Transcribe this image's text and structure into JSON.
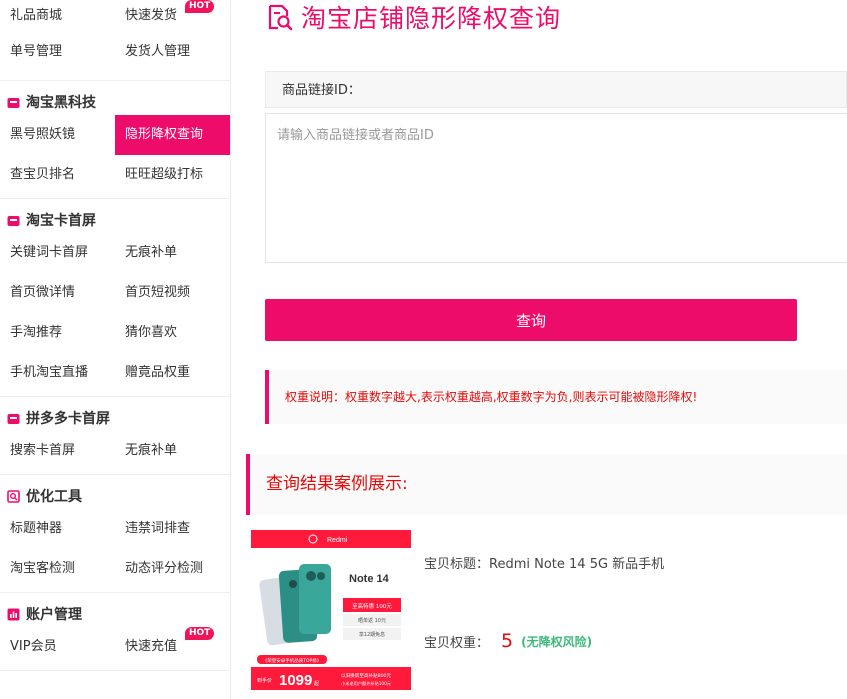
{
  "sidebar": {
    "top_rows": [
      [
        {
          "label": "礼品商城",
          "hot": false
        },
        {
          "label": "快速发货",
          "hot": true
        }
      ],
      [
        {
          "label": "单号管理",
          "hot": false
        },
        {
          "label": "发货人管理",
          "hot": false
        }
      ]
    ],
    "groups": [
      {
        "title": "淘宝黑科技",
        "items": [
          {
            "label": "黑号照妖镜"
          },
          {
            "label": "隐形降权查询",
            "active": true
          },
          {
            "label": "查宝贝排名"
          },
          {
            "label": "旺旺超级打标"
          }
        ]
      },
      {
        "title": "淘宝卡首屏",
        "items": [
          {
            "label": "关键词卡首屏"
          },
          {
            "label": "无痕补单"
          },
          {
            "label": "首页微详情"
          },
          {
            "label": "首页短视频"
          },
          {
            "label": "手淘推荐"
          },
          {
            "label": "猜你喜欢"
          },
          {
            "label": "手机淘宝直播"
          },
          {
            "label": "赠竟品权重"
          }
        ]
      },
      {
        "title": "拼多多卡首屏",
        "items": [
          {
            "label": "搜索卡首屏"
          },
          {
            "label": "无痕补单"
          }
        ]
      },
      {
        "title": "优化工具",
        "items": [
          {
            "label": "标题神器"
          },
          {
            "label": "违禁词排查"
          },
          {
            "label": "淘宝客检测"
          },
          {
            "label": "动态评分检测"
          }
        ]
      },
      {
        "title": "账户管理",
        "items": [
          {
            "label": "VIP会员"
          },
          {
            "label": "快速充值",
            "hot": true
          }
        ]
      }
    ],
    "hot_label": "HOT"
  },
  "main": {
    "title": "淘宝店铺隐形降权查询",
    "field_label": "商品链接ID：",
    "input_placeholder": "请输入商品链接或者商品ID",
    "input_value": "",
    "query_button": "查询",
    "notice": "权重说明：权重数字越大,表示权重越高,权重数字为负,则表示可能被隐形降权!",
    "result_header": "查询结果案例展示:",
    "product": {
      "title_label": "宝贝标题：",
      "title_value": "Redmi Note 14 5G 新品手机",
      "weight_label": "宝贝权重：",
      "weight_value": "5",
      "risk_text": "(无降权风险)",
      "image": {
        "brand": "Redmi",
        "model": "Note 14",
        "promo1": "至高特惠 100元",
        "promo2": "晒单返 10元",
        "promo3": "享12期免息",
        "badge": "《荣登安卓手机品质TOP榜》",
        "price_prefix": "到手价",
        "price": "1099",
        "price_suffix": "起",
        "subsidy1": "以旧换新至高补贴800元",
        "subsidy2": "小米老用户额外补贴100元"
      }
    }
  },
  "colors": {
    "accent": "#ee0c6a",
    "alert": "#e50b0b",
    "ok": "#3cba7a"
  }
}
